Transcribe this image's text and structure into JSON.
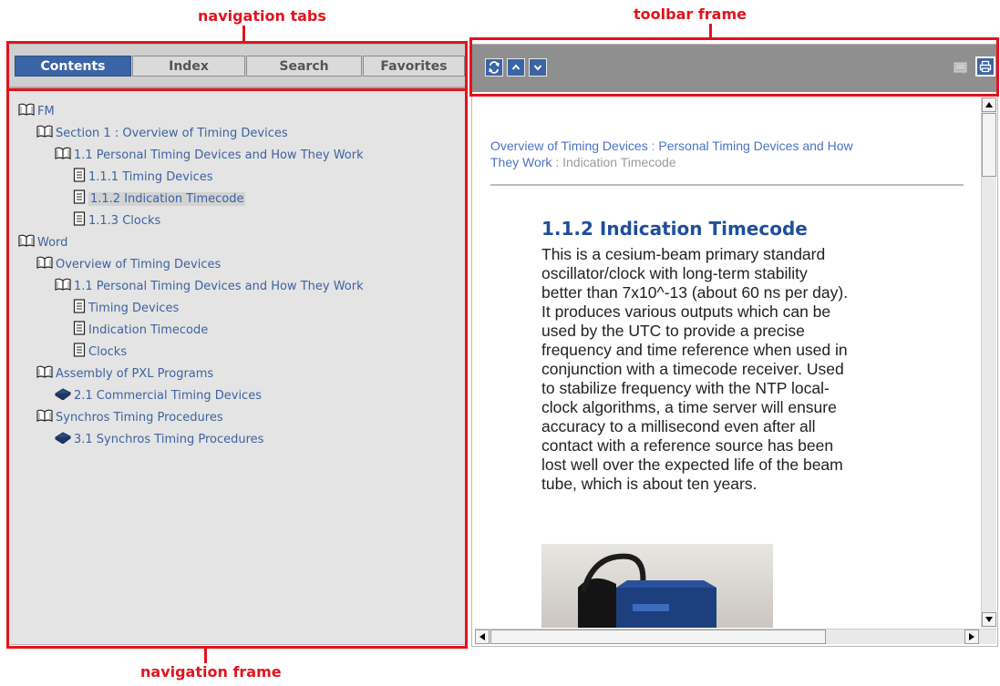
{
  "annotations": {
    "navigation_tabs": "navigation tabs",
    "toolbar_frame": "toolbar frame",
    "navigation_frame": "navigation frame"
  },
  "tabs": [
    {
      "label": "Contents",
      "active": true
    },
    {
      "label": "Index",
      "active": false
    },
    {
      "label": "Search",
      "active": false
    },
    {
      "label": "Favorites",
      "active": false
    }
  ],
  "toc": [
    {
      "label": "FM",
      "icon": "open-book-icon"
    },
    {
      "label": "Section 1 : Overview of Timing Devices",
      "icon": "open-book-icon"
    },
    {
      "label": "1.1 Personal Timing Devices and How They Work",
      "icon": "open-book-icon"
    },
    {
      "label": "1.1.1 Timing Devices",
      "icon": "page-icon"
    },
    {
      "label": "1.1.2 Indication Timecode",
      "icon": "page-icon",
      "selected": true
    },
    {
      "label": "1.1.3 Clocks",
      "icon": "page-icon"
    },
    {
      "label": "Word",
      "icon": "open-book-icon"
    },
    {
      "label": "Overview of Timing Devices",
      "icon": "open-book-icon"
    },
    {
      "label": "1.1 Personal Timing Devices and How They Work",
      "icon": "open-book-icon"
    },
    {
      "label": "Timing Devices",
      "icon": "page-icon"
    },
    {
      "label": "Indication Timecode",
      "icon": "page-icon"
    },
    {
      "label": "Clocks",
      "icon": "page-icon"
    },
    {
      "label": "Assembly of PXL Programs",
      "icon": "open-book-icon"
    },
    {
      "label": "2.1 Commercial Timing Devices",
      "icon": "closed-book-icon"
    },
    {
      "label": "Synchros Timing Procedures",
      "icon": "open-book-icon"
    },
    {
      "label": "3.1 Synchros Timing Procedures",
      "icon": "closed-book-icon"
    }
  ],
  "toolbar": {
    "sync_icon": "sync-toc-icon",
    "prev_icon": "previous-topic-icon",
    "next_icon": "next-topic-icon",
    "notes_icon": "notes-icon",
    "print_icon": "print-icon"
  },
  "breadcrumb": {
    "link1": "Overview of Timing Devices",
    "separator": ":",
    "link2_line1": "Personal Timing Devices and How",
    "link2_line2": "They Work",
    "current": "Indication Timecode"
  },
  "topic": {
    "title": "1.1.2  Indication Timecode",
    "body_lines": [
      "This is a cesium-beam primary standard",
      "oscillator/clock with long-term stability",
      "better than 7x10^-13 (about 60 ns per day).",
      "It produces various outputs which can be",
      "used by the UTC to provide a precise",
      "frequency and time reference when used in",
      "conjunction with a timecode receiver. Used",
      "to stabilize frequency with the NTP local-",
      "clock algorithms, a time server will ensure",
      "accuracy to a millisecond even after all",
      "contact with a reference source has been",
      "lost well over the expected life of the beam",
      "tube, which is about ten years."
    ]
  },
  "colors": {
    "annotation_red": "#e1141e",
    "accent_blue": "#3a64a5",
    "link_blue": "#3e62a0"
  }
}
